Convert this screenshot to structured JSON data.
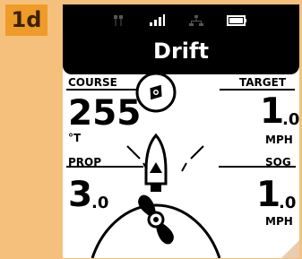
{
  "figure_label": "1d",
  "mode": "Drift",
  "status_icons": [
    "anchor-icon",
    "signal-icon",
    "network-icon",
    "battery-icon"
  ],
  "course": {
    "label": "COURSE",
    "value": "255",
    "unit": "°T"
  },
  "target": {
    "label": "TARGET",
    "value_main": "1",
    "value_dec": ".0",
    "unit": "MPH"
  },
  "prop": {
    "label": "PROP",
    "value_main": "3",
    "value_dec": ".0"
  },
  "sog": {
    "label": "SOG",
    "value_main": "1",
    "value_dec": ".0",
    "unit": "MPH"
  }
}
